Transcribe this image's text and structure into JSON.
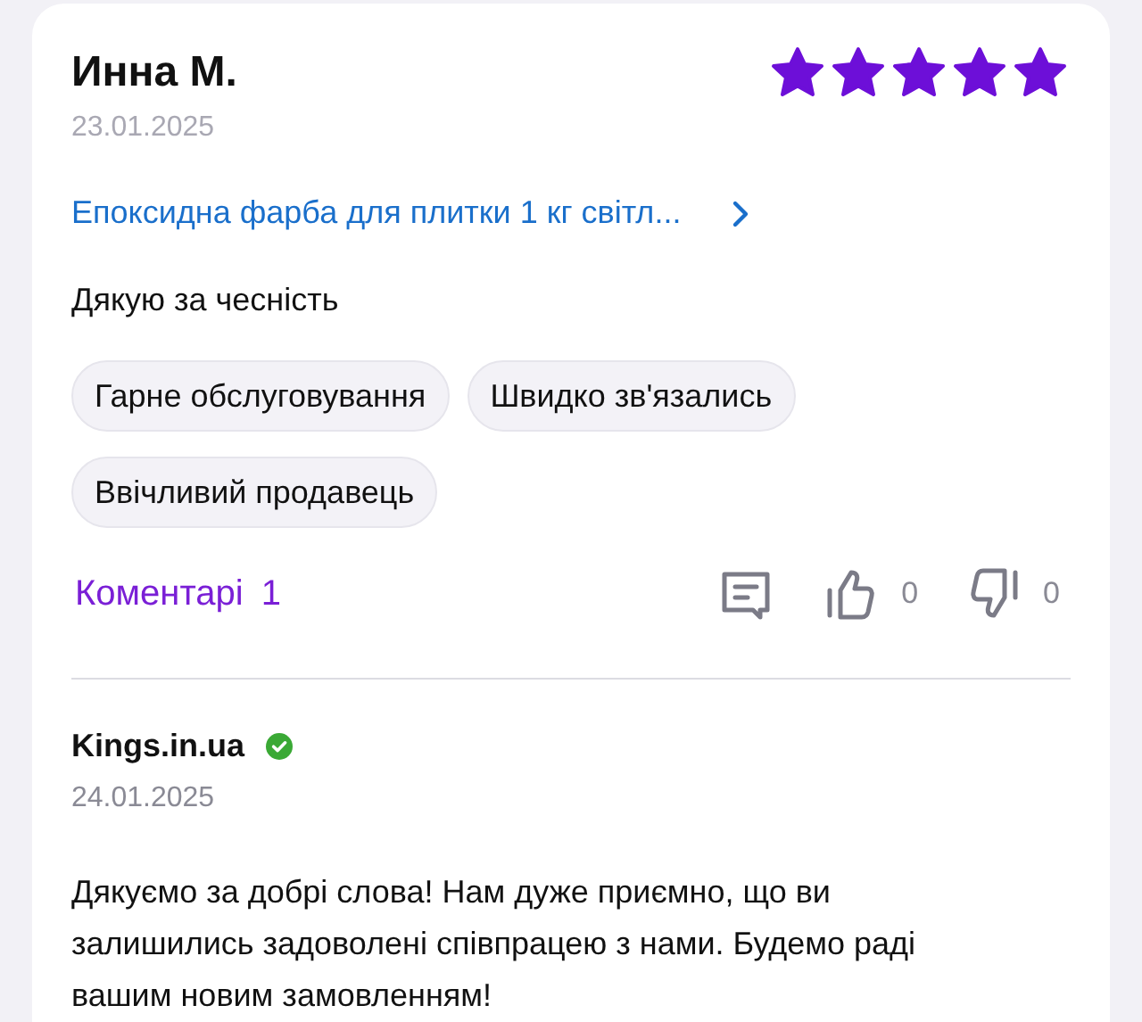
{
  "review": {
    "author": "Инна М.",
    "date": "23.01.2025",
    "stars": 5,
    "product": "Епоксидна фарба для плитки 1 кг світл...",
    "text": "Дякую за чесність",
    "tags": [
      "Гарне обслуговування",
      "Швидко зв'язались",
      "Ввічливий продавець"
    ],
    "comments_label": "Коментарі",
    "comments_count": "1",
    "likes": "0",
    "dislikes": "0"
  },
  "reply": {
    "author": "Kings.in.ua",
    "verified": true,
    "date": "24.01.2025",
    "text": "Дякуємо за добрі слова! Нам дуже приємно, що ви залишились задоволені співпрацею з нами. Будемо раді вашим новим замовленням!"
  }
}
